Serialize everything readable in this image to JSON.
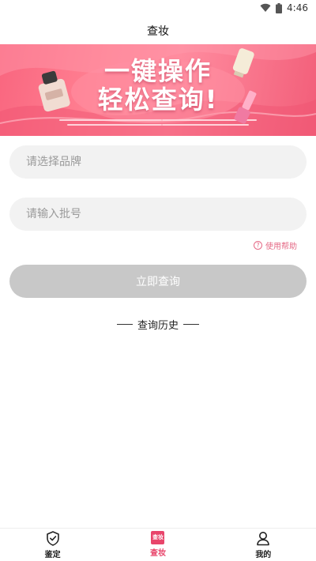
{
  "status_bar": {
    "time": "4:46"
  },
  "header": {
    "title": "查妆"
  },
  "banner": {
    "line1": "一键操作",
    "line2": "轻松查询!"
  },
  "form": {
    "brand_placeholder": "请选择品牌",
    "batch_placeholder": "请输入批号",
    "help_icon_glyph": "?",
    "help_label": "使用帮助",
    "submit_label": "立即查询"
  },
  "history": {
    "title": "查询历史"
  },
  "tabbar": {
    "tabs": [
      {
        "label": "鉴定",
        "icon": "shield-check-icon"
      },
      {
        "label": "查妆",
        "icon": "query-makeup-icon",
        "icon_text": "查妆",
        "active": true
      },
      {
        "label": "我的",
        "icon": "user-icon"
      }
    ]
  },
  "colors": {
    "accent": "#e8456b",
    "banner": "#f9667f",
    "button_disabled": "#c8c8c8",
    "field_bg": "#f2f2f2"
  }
}
